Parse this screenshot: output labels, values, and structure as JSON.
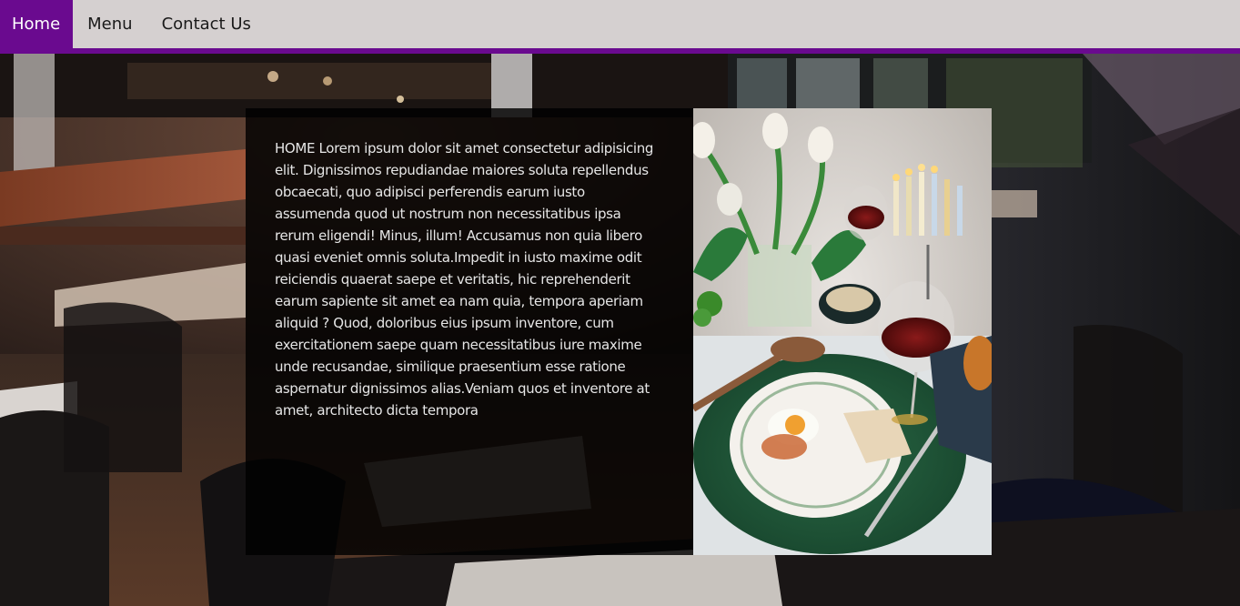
{
  "nav": {
    "items": [
      {
        "label": "Home",
        "active": true
      },
      {
        "label": "Menu",
        "active": false
      },
      {
        "label": "Contact Us",
        "active": false
      }
    ]
  },
  "content": {
    "paragraph": "HOME Lorem ipsum dolor sit amet consectetur adipisicing elit. Dignissimos repudiandae maiores soluta repellendus obcaecati, quo adipisci perferendis earum iusto assumenda quod ut nostrum non necessitatibus ipsa rerum eligendi! Minus, illum! Accusamus non quia libero quasi eveniet omnis soluta.Impedit in iusto maxime odit reiciendis quaerat saepe et veritatis, hic reprehenderit earum sapiente sit amet ea nam quia, tempora aperiam aliquid ? Quod, doloribus eius ipsum inventore, cum exercitationem saepe quam necessitatibus iure maxime unde recusandae, similique praesentium esse ratione aspernatur dignissimos alias.Veniam quos et inventore at amet, architecto dicta tempora"
  },
  "colors": {
    "accent": "#6a0a8f",
    "navbar_bg": "#d5d0d0",
    "card_bg": "rgba(0,0,0,0.82)",
    "text": "#e6e6e6"
  },
  "images": {
    "background": "restaurant-interior-photo",
    "feature": "festive-table-food-photo"
  }
}
